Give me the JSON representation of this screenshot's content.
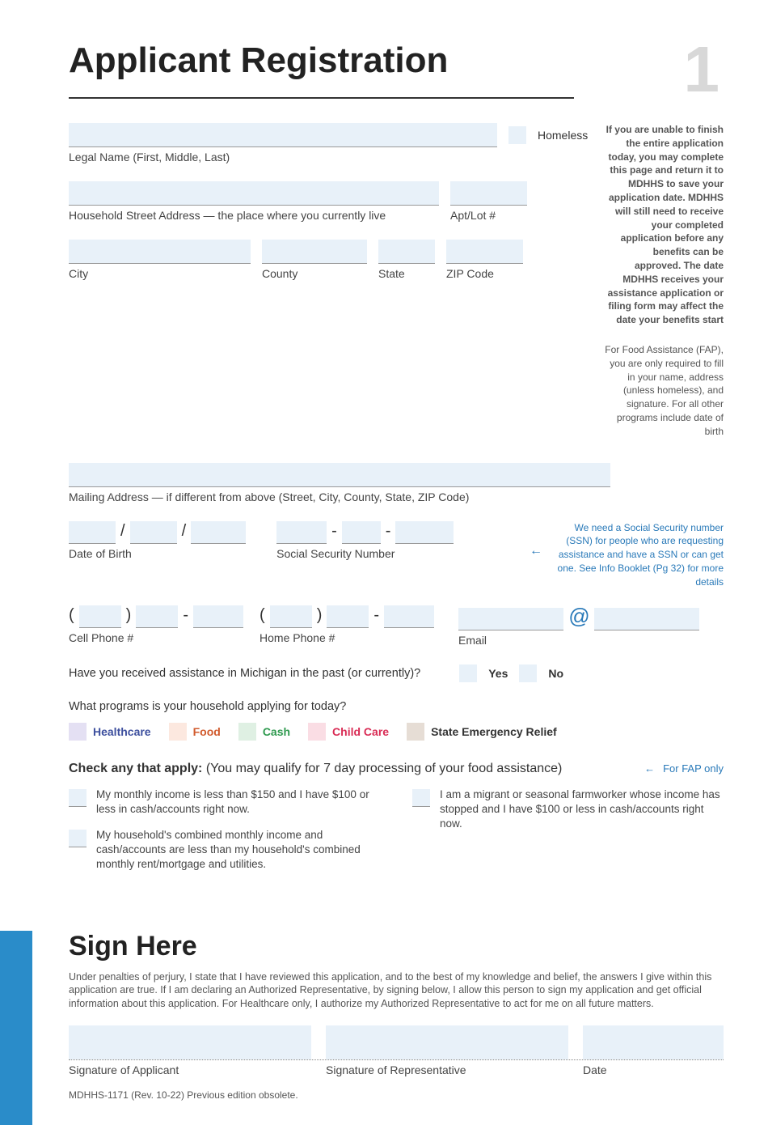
{
  "page_number": "1",
  "title": "Applicant Registration",
  "sidebar": {
    "note1": "If you are unable to finish the entire application today, you may complete this page and return it to MDHHS to save your application date. MDHHS will still need to receive your completed application before any benefits can be approved. The date MDHHS receives your assistance application or filing form may affect the date your benefits start",
    "note2": "For Food Assistance (FAP), you are only required to fill in your name, address (unless homeless), and signature. For all other programs include date of birth",
    "ssn_note": "We need a Social Security number (SSN) for people who are requesting assistance and have a SSN or can get one. See Info Booklet (Pg 32) for more details"
  },
  "labels": {
    "homeless": "Homeless",
    "legal_name": "Legal Name (First, Middle, Last)",
    "street": "Household Street Address — the place where you currently live",
    "aptlot": "Apt/Lot #",
    "city": "City",
    "county": "County",
    "state": "State",
    "zip": "ZIP Code",
    "mailing": "Mailing Address — if different from above (Street, City, County, State, ZIP Code)",
    "dob": "Date of Birth",
    "ssn": "Social Security Number",
    "cell": "Cell Phone #",
    "home": "Home Phone #",
    "email": "Email",
    "yes": "Yes",
    "no": "No"
  },
  "questions": {
    "past_assistance": "Have you received assistance in Michigan in the past (or currently)?",
    "programs": "What programs is your household applying for today?"
  },
  "programs": {
    "healthcare": "Healthcare",
    "food": "Food",
    "cash": "Cash",
    "childcare": "Child Care",
    "ser": "State Emergency Relief"
  },
  "check_apply": {
    "heading_bold": "Check any that apply:",
    "heading_rest": " (You may qualify for 7 day processing of your food assistance)",
    "fap_only": "For FAP only",
    "item1": "My monthly income is less than $150 and I have $100 or less in cash/accounts right now.",
    "item2": "My household's combined monthly income and cash/accounts are less than my household's combined monthly rent/mortgage and utilities.",
    "item3": "I am a migrant or seasonal farmworker whose income has stopped and I have $100 or less in cash/accounts right now."
  },
  "sign": {
    "title": "Sign Here",
    "text": "Under penalties of perjury, I state that I have reviewed this application, and to the best of my knowledge and belief, the answers I give within this application are true. If I am declaring an Authorized Representative, by signing below, I allow this person to sign my application and get official information about this application. For Healthcare only, I authorize my Authorized Representative to act for me on all future matters.",
    "sig_applicant": "Signature of Applicant",
    "sig_rep": "Signature of Representative",
    "date": "Date"
  },
  "footer": "MDHHS-1171 (Rev. 10-22) Previous edition obsolete."
}
